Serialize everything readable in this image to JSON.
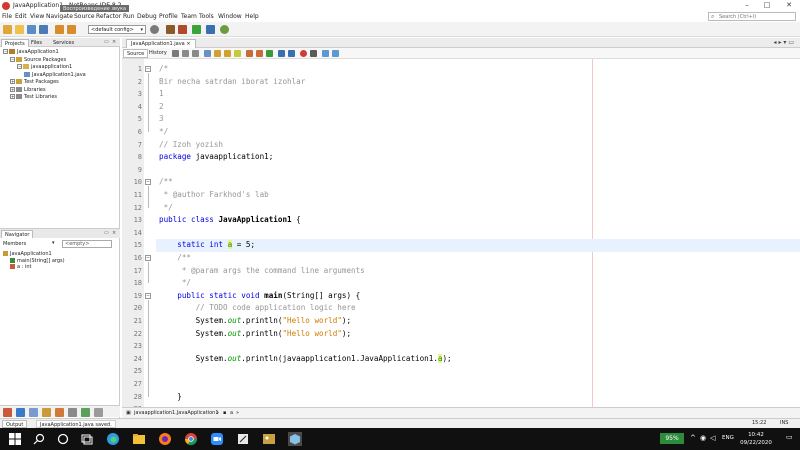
{
  "window": {
    "title": "JavaApplication1 - NetBeans IDE 8.2",
    "tooltip": "Воспроизведение звука"
  },
  "menu": [
    "File",
    "Edit",
    "View",
    "Navigate",
    "Source",
    "Refactor",
    "Run",
    "Debug",
    "Profile",
    "Team",
    "Tools",
    "Window",
    "Help"
  ],
  "search": {
    "placeholder": "Search (Ctrl+I)"
  },
  "toolbar": {
    "config_value": "<default config>"
  },
  "projects_panel": {
    "tabs": [
      "Projects",
      "Files",
      "Services"
    ],
    "tree": [
      {
        "label": "JavaApplication1",
        "level": 0,
        "expander": "−",
        "icon_color": "#b07c2a"
      },
      {
        "label": "Source Packages",
        "level": 1,
        "expander": "−",
        "icon_color": "#c9a13b"
      },
      {
        "label": "javaapplication1",
        "level": 2,
        "expander": "−",
        "icon_color": "#d8b14a"
      },
      {
        "label": "JavaApplication1.java",
        "level": 3,
        "expander": "",
        "icon_color": "#6a8fc4"
      },
      {
        "label": "Test Packages",
        "level": 1,
        "expander": "+",
        "icon_color": "#c9a13b"
      },
      {
        "label": "Libraries",
        "level": 1,
        "expander": "+",
        "icon_color": "#8a8a8a"
      },
      {
        "label": "Test Libraries",
        "level": 1,
        "expander": "+",
        "icon_color": "#8a8a8a"
      }
    ]
  },
  "navigator_panel": {
    "title": "Navigator",
    "members_label": "Members",
    "empty_select": "<empty>",
    "tree": [
      {
        "label": "JavaApplication1",
        "level": 0
      },
      {
        "label": "main(String[] args)",
        "level": 1
      },
      {
        "label": "a : int",
        "level": 1
      }
    ]
  },
  "editor": {
    "file_tab": "JavaApplication1.java",
    "source_label": "Source",
    "history_label": "History",
    "highlight_line": 15,
    "lines": [
      {
        "n": "1",
        "fold": "−",
        "segments": [
          {
            "t": "/*",
            "c": "c-cmt"
          }
        ]
      },
      {
        "n": "2",
        "segments": [
          {
            "t": "Bir necha satrdan iborat izohlar",
            "c": "c-cmt"
          }
        ]
      },
      {
        "n": "3",
        "segments": [
          {
            "t": "1",
            "c": "c-cmt"
          }
        ]
      },
      {
        "n": "4",
        "segments": [
          {
            "t": "2",
            "c": "c-cmt"
          }
        ]
      },
      {
        "n": "5",
        "segments": [
          {
            "t": "3",
            "c": "c-cmt"
          }
        ]
      },
      {
        "n": "6",
        "segments": [
          {
            "t": "*/",
            "c": "c-cmt"
          }
        ]
      },
      {
        "n": "7",
        "segments": [
          {
            "t": "// Izoh yozish",
            "c": "c-cmt"
          }
        ]
      },
      {
        "n": "8",
        "segments": [
          {
            "t": "package ",
            "c": "c-kw"
          },
          {
            "t": "javaapplication1;",
            "c": ""
          }
        ]
      },
      {
        "n": "9",
        "segments": []
      },
      {
        "n": "10",
        "fold": "−",
        "segments": [
          {
            "t": "/**",
            "c": "c-cmt"
          }
        ]
      },
      {
        "n": "11",
        "segments": [
          {
            "t": " * @author Farkhod's lab",
            "c": "c-cmt"
          }
        ]
      },
      {
        "n": "12",
        "segments": [
          {
            "t": " */",
            "c": "c-cmt"
          }
        ]
      },
      {
        "n": "13",
        "segments": [
          {
            "t": "public class ",
            "c": "c-kw"
          },
          {
            "t": "JavaApplication1",
            "c": "c-bold"
          },
          {
            "t": " {",
            "c": ""
          }
        ]
      },
      {
        "n": "14",
        "segments": []
      },
      {
        "n": "15",
        "segments": [
          {
            "t": "    static int ",
            "c": "c-kw"
          },
          {
            "t": "a",
            "c": "c-fld c-mark"
          },
          {
            "t": " = 5;",
            "c": ""
          }
        ]
      },
      {
        "n": "16",
        "fold": "−",
        "segments": [
          {
            "t": "    /**",
            "c": "c-cmt"
          }
        ]
      },
      {
        "n": "17",
        "segments": [
          {
            "t": "     * @param args the command line arguments",
            "c": "c-cmt"
          }
        ]
      },
      {
        "n": "18",
        "segments": [
          {
            "t": "     */",
            "c": "c-cmt"
          }
        ]
      },
      {
        "n": "19",
        "fold": "−",
        "segments": [
          {
            "t": "    public static void ",
            "c": "c-kw"
          },
          {
            "t": "main",
            "c": "c-bold"
          },
          {
            "t": "(String[] args) {",
            "c": ""
          }
        ]
      },
      {
        "n": "20",
        "segments": [
          {
            "t": "        // TODO code application logic here",
            "c": "c-cmt"
          }
        ]
      },
      {
        "n": "21",
        "segments": [
          {
            "t": "        System.",
            "c": ""
          },
          {
            "t": "out",
            "c": "c-stat"
          },
          {
            "t": ".println(",
            "c": ""
          },
          {
            "t": "\"Hello world\"",
            "c": "c-str"
          },
          {
            "t": ");",
            "c": ""
          }
        ]
      },
      {
        "n": "22",
        "segments": [
          {
            "t": "        System.",
            "c": ""
          },
          {
            "t": "out",
            "c": "c-stat"
          },
          {
            "t": ".println(",
            "c": ""
          },
          {
            "t": "\"Hello world\"",
            "c": "c-str"
          },
          {
            "t": ");",
            "c": ""
          }
        ]
      },
      {
        "n": "23",
        "segments": []
      },
      {
        "n": "24",
        "segments": [
          {
            "t": "        System.",
            "c": ""
          },
          {
            "t": "out",
            "c": "c-stat"
          },
          {
            "t": ".println(javaapplication1.JavaApplication1.",
            "c": ""
          },
          {
            "t": "a",
            "c": "c-fld c-mark"
          },
          {
            "t": ");",
            "c": ""
          }
        ]
      },
      {
        "n": "25",
        "segments": []
      },
      {
        "n": "27",
        "segments": []
      },
      {
        "n": "28",
        "segments": [
          {
            "t": "    }",
            "c": ""
          }
        ]
      },
      {
        "n": "29",
        "segments": []
      }
    ],
    "breadcrumb": [
      "javaapplication1.JavaApplication1",
      "a"
    ]
  },
  "statusbar": {
    "output_label": "Output",
    "saved_message": "JavaApplication1.java saved.",
    "position": "15:22",
    "insert_mode": "INS"
  },
  "taskbar": {
    "battery": "95%",
    "time": "10:42",
    "date": "09/22/2020"
  }
}
